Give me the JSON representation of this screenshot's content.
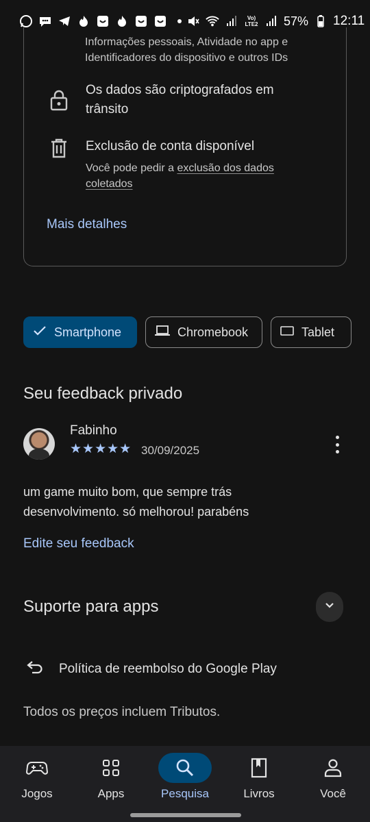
{
  "status_bar": {
    "battery": "57%",
    "time": "12:11",
    "network": "Vo) LTE2",
    "left_icons": [
      "whatsapp-icon",
      "chat-icon",
      "telegram-icon",
      "flame-icon",
      "box-icon",
      "flame-icon",
      "box-icon",
      "box-icon",
      "dot-icon"
    ]
  },
  "data_safety": {
    "collected_text": "Informações pessoais, Atividade no app e Identificadores do dispositivo e outros IDs",
    "encrypted_text": "Os dados são criptografados em trânsito",
    "deletion_title": "Exclusão de conta disponível",
    "deletion_sub_prefix": "Você pode pedir a ",
    "deletion_sub_link": "exclusão dos dados coletados",
    "more_details": "Mais detalhes"
  },
  "device_chips": [
    {
      "label": "Smartphone",
      "selected": true
    },
    {
      "label": "Chromebook",
      "selected": false
    },
    {
      "label": "Tablet",
      "selected": false
    }
  ],
  "private_feedback": {
    "title": "Seu feedback privado",
    "reviewer": "Fabinho",
    "stars": "★★★★★",
    "rating": 5,
    "date": "30/09/2025",
    "text": "um game muito bom, que sempre trás desenvolvimento. só melhorou! parabéns",
    "edit_link": "Edite seu feedback"
  },
  "app_support": {
    "title": "Suporte para apps"
  },
  "refund_policy": "Política de reembolso do Google Play",
  "taxes_note": "Todos os preços incluem Tributos.",
  "bottom_nav": [
    {
      "label": "Jogos",
      "icon": "gamepad-icon",
      "active": false
    },
    {
      "label": "Apps",
      "icon": "apps-grid-icon",
      "active": false
    },
    {
      "label": "Pesquisa",
      "icon": "search-icon",
      "active": true
    },
    {
      "label": "Livros",
      "icon": "book-icon",
      "active": false
    },
    {
      "label": "Você",
      "icon": "person-icon",
      "active": false
    }
  ],
  "colors": {
    "background": "#141414",
    "accent": "#a8c7fa",
    "selected_chip": "#004a77",
    "nav_background": "#1f1f22"
  }
}
